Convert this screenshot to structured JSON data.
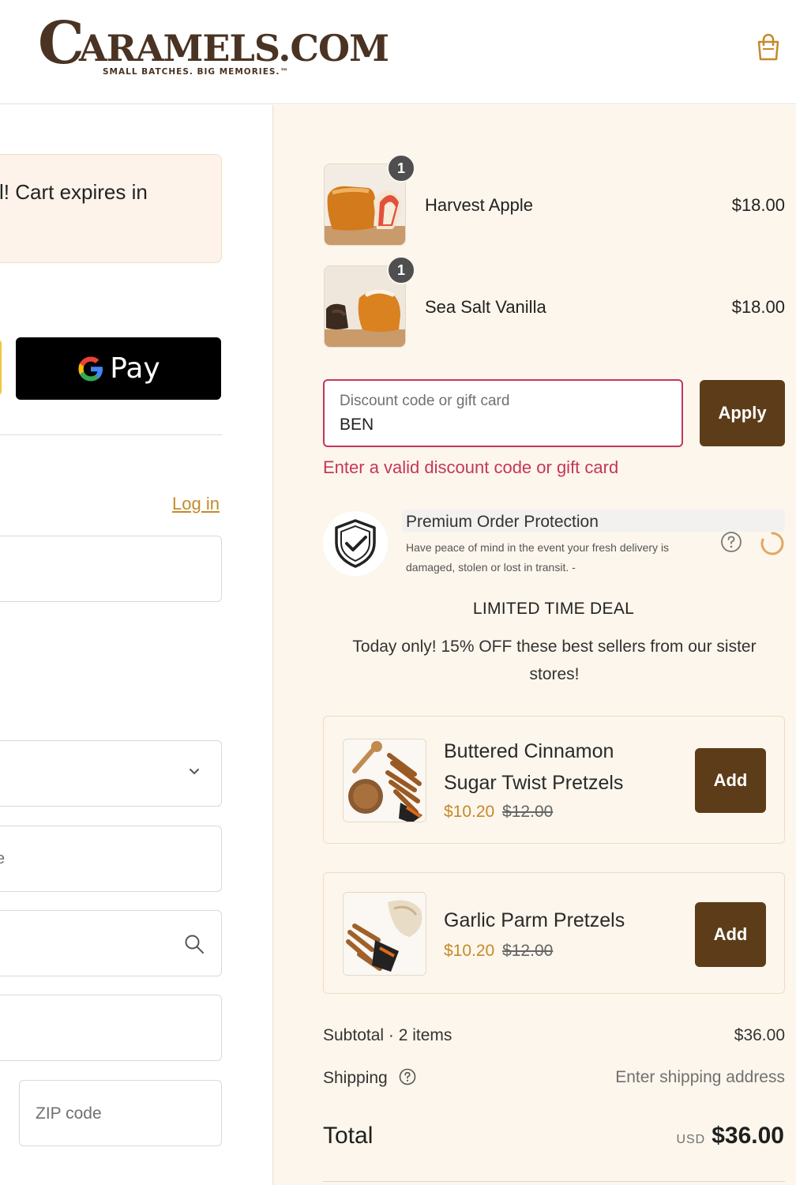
{
  "brand": {
    "logo_initial": "C",
    "logo_rest": "ARAMELS.COM",
    "tagline": "SMALL BATCHES. BIG MEMORIES.™"
  },
  "left": {
    "cart_expiry_text": "l! Cart expires in",
    "gpay_label": "Pay",
    "login_link": "Log in",
    "address_partial": "e",
    "zip_placeholder": "ZIP code"
  },
  "cart": {
    "items": [
      {
        "name": "Harvest Apple",
        "price": "$18.00",
        "quantity": "1"
      },
      {
        "name": "Sea Salt Vanilla",
        "price": "$18.00",
        "quantity": "1"
      }
    ]
  },
  "discount": {
    "label": "Discount code or gift card",
    "value": "BEN",
    "apply_label": "Apply",
    "error": "Enter a valid discount code or gift card"
  },
  "protection": {
    "title": "Premium Order Protection",
    "description": "Have peace of mind in the event your fresh delivery is damaged, stolen or lost in transit. -"
  },
  "deal": {
    "title": "LIMITED TIME DEAL",
    "text": "Today only! 15% OFF these best sellers from our sister stores!"
  },
  "upsells": [
    {
      "name": "Buttered Cinnamon Sugar Twist Pretzels",
      "price": "$10.20",
      "compare_price": "$12.00",
      "button": "Add"
    },
    {
      "name": "Garlic Parm Pretzels",
      "price": "$10.20",
      "compare_price": "$12.00",
      "button": "Add"
    }
  ],
  "summary": {
    "subtotal_label": "Subtotal · 2 items",
    "subtotal_value": "$36.00",
    "shipping_label": "Shipping",
    "shipping_value": "Enter shipping address",
    "total_label": "Total",
    "currency": "USD",
    "total_value": "$36.00"
  },
  "colors": {
    "brand_brown": "#5d3d19",
    "accent_gold": "#c48a2c",
    "error_pink": "#c4365c",
    "summary_bg": "#fdf6ec"
  }
}
